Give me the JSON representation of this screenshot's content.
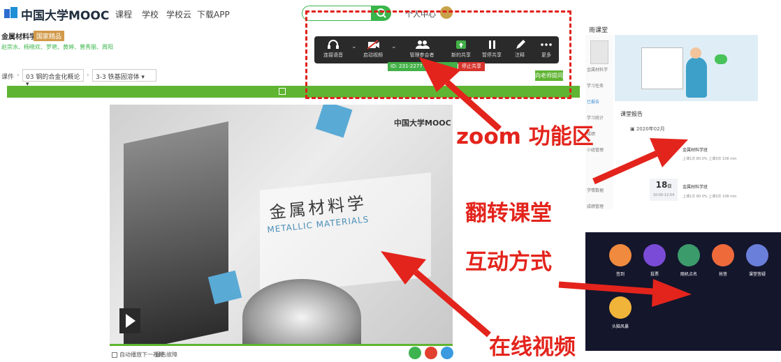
{
  "mooc": {
    "logo": "中国大学MOOC",
    "nav": [
      "课程",
      "学校",
      "学校云",
      "下载APP"
    ],
    "personal": "个人中心",
    "course_title": "金属材料学",
    "course_badge": "国家精品",
    "course_teachers": "赵宗水、杨晓欢、罗艳、黄婷、曾秀丽、周阳",
    "breadcrumb_lead": "课件",
    "chapter": "03 钢的合金化概论",
    "section": "3-3 铁基固溶体",
    "ask_teacher": "向老师提问"
  },
  "zoom": {
    "toolbar": [
      {
        "icon": "headphones-icon",
        "label": "连接语音"
      },
      {
        "icon": "video-off-icon",
        "label": "启动视频"
      },
      {
        "icon": "participants-icon",
        "label": "管理参会者"
      },
      {
        "icon": "share-screen-icon",
        "label": "新的共享"
      },
      {
        "icon": "pause-icon",
        "label": "暂停共享"
      },
      {
        "icon": "pen-icon",
        "label": "注释"
      },
      {
        "icon": "more-icon",
        "label": "更多"
      }
    ],
    "meeting_id": "ID: 231-2277",
    "stop_share": "停止共享"
  },
  "video": {
    "logo": "中国大学MOOC",
    "title_cn": "金属材料学",
    "title_en": "METALLIC MATERIALS",
    "autoplay": "自动播放下一视频",
    "report": "报告故障"
  },
  "flip": {
    "logo": "雨课堂",
    "side_items": [
      "金属材料学",
      "学习任务",
      "已报告",
      "学习统计",
      "成绩",
      "小组管理",
      "学情数据",
      "成绩管理"
    ],
    "report_title": "课堂报告",
    "date": "2020年02月",
    "rows": [
      {
        "title": "金属材料学班",
        "meta": "上课1次 80.0%  上课3次 108 min"
      },
      {
        "title": "金属材料学班",
        "meta": "上课1次 80.0%  上课3次 108 min"
      }
    ],
    "date_num": "18",
    "date_unit": "日",
    "date_sub": "10:00-12:54"
  },
  "interact": {
    "items": [
      "签到",
      "投票",
      "随机点名",
      "抢答",
      "课堂答疑",
      "头脑风暴"
    ],
    "colors": [
      "#f08a3e",
      "#7a4bd6",
      "#3b9b6a",
      "#ee6a3a",
      "#6a7fd9",
      "#f0b43a"
    ]
  },
  "annotations": {
    "zoom": "zoom 功能区",
    "flip": "翻转课堂",
    "interact": "互动方式",
    "video": "在线视频"
  },
  "colors": {
    "accent_green": "#5fb431",
    "annotation_red": "#e3241c",
    "zoom_bar": "#2a2a2a",
    "interact_bg": "#14162c"
  }
}
